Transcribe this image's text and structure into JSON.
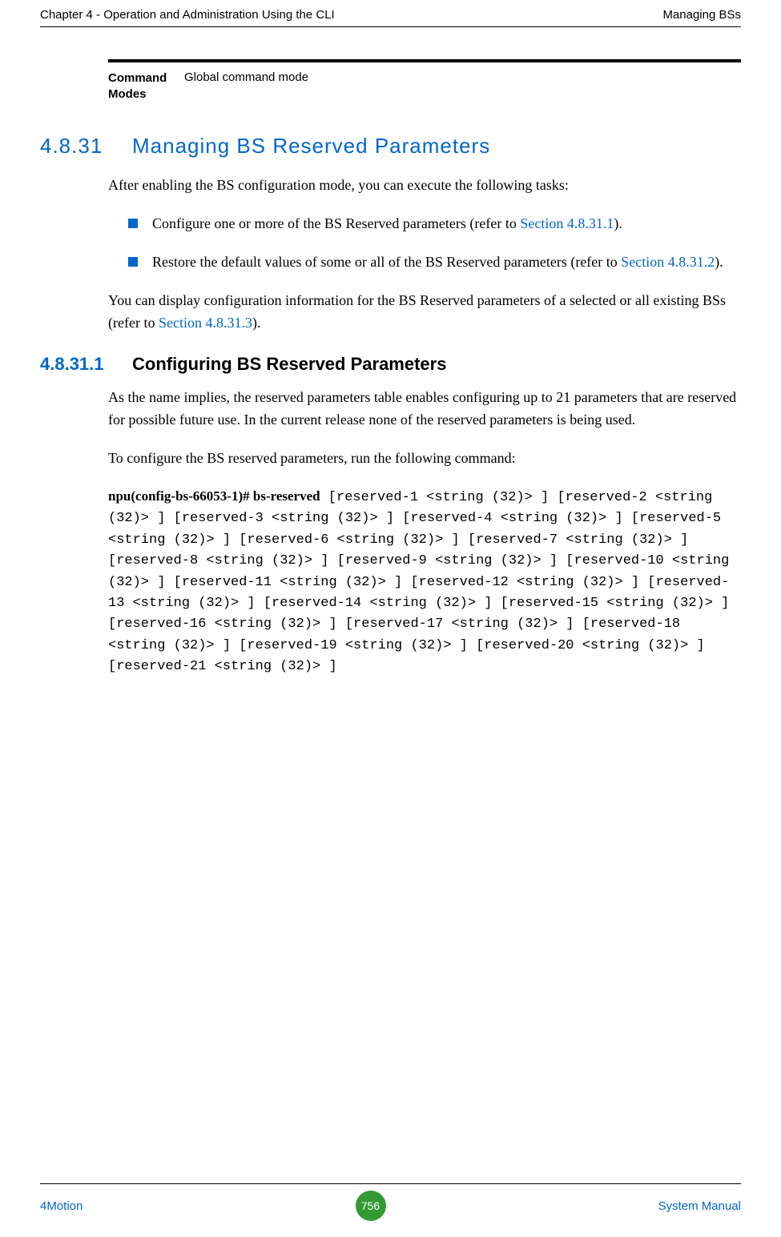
{
  "header": {
    "left": "Chapter 4 - Operation and Administration Using the CLI",
    "right": "Managing BSs"
  },
  "cmdmodes": {
    "label": "Command Modes",
    "value": "Global command mode"
  },
  "section_h2": {
    "num": "4.8.31",
    "title": "Managing BS Reserved Parameters"
  },
  "intro_para": "After enabling the BS configuration mode, you can execute the following tasks:",
  "bullets": {
    "b1_pre": "Configure one or more of the BS Reserved parameters (refer to ",
    "b1_link": "Section 4.8.31.1",
    "b1_post": ").",
    "b2_pre": "Restore the default values of some or all of the BS Reserved parameters (refer to ",
    "b2_link": "Section 4.8.31.2",
    "b2_post": ")."
  },
  "display_para_pre": "You can display configuration information for the BS Reserved parameters of a selected or all existing BSs (refer to ",
  "display_para_link": "Section 4.8.31.3",
  "display_para_post": ").",
  "section_h3": {
    "num": "4.8.31.1",
    "title": "Configuring BS Reserved Parameters"
  },
  "h3_para1": "As the name implies, the reserved parameters table enables configuring up to 21 parameters that are reserved for possible future use. In the current release none of the reserved parameters is being used.",
  "h3_para2": "To configure the BS reserved parameters, run the following command:",
  "cmd_bold": "npu(config-bs-66053-1)# bs-reserved",
  "cmd_rest": " [reserved-1 <string (32)> ] [reserved-2 <string (32)> ] [reserved-3 <string (32)> ] [reserved-4 <string (32)> ] [reserved-5 <string (32)> ] [reserved-6 <string (32)> ] [reserved-7 <string (32)> ] [reserved-8 <string (32)> ] [reserved-9 <string (32)> ] [reserved-10 <string (32)> ] [reserved-11 <string (32)> ] [reserved-12 <string (32)> ] [reserved-13 <string (32)> ] [reserved-14 <string (32)> ] [reserved-15 <string (32)> ] [reserved-16 <string (32)> ] [reserved-17 <string (32)> ] [reserved-18 <string (32)> ] [reserved-19 <string (32)> ] [reserved-20 <string (32)> ] [reserved-21 <string (32)> ]",
  "footer": {
    "left": "4Motion",
    "page": "756",
    "right": "System Manual"
  }
}
